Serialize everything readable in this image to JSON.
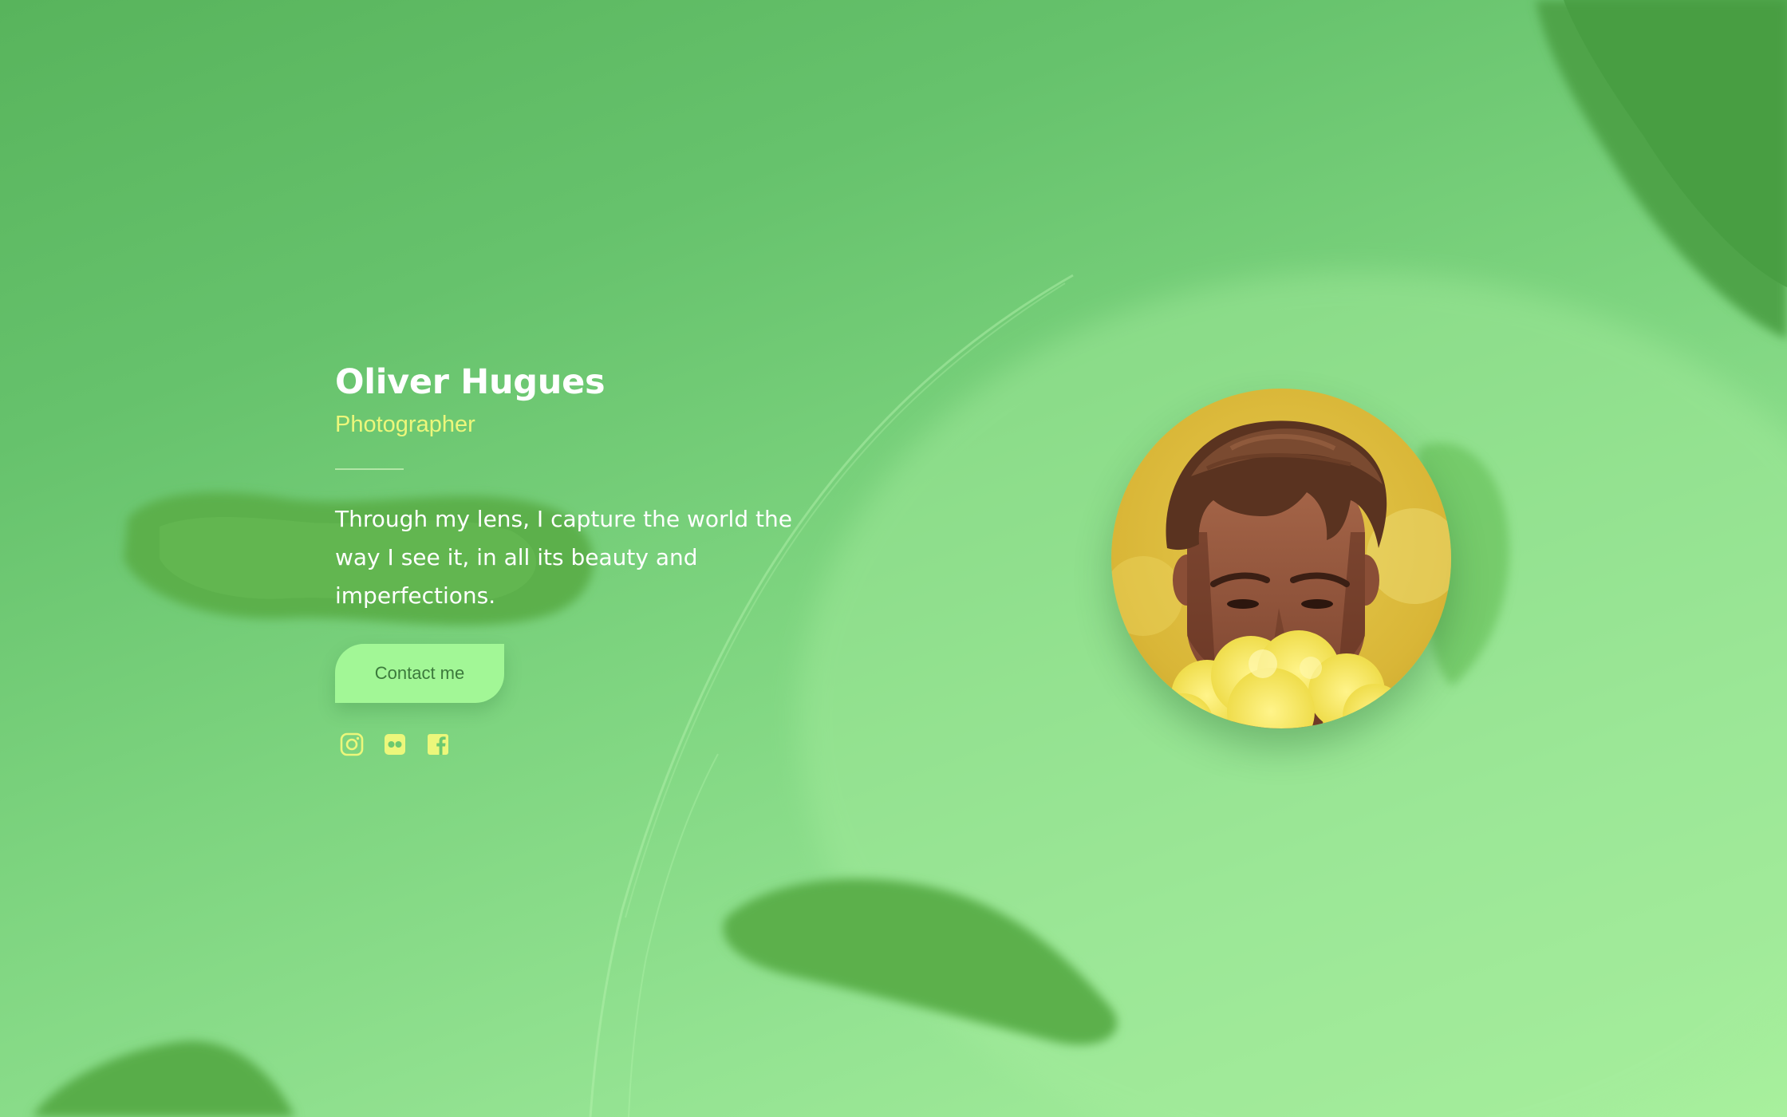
{
  "profile": {
    "name": "Oliver Hugues",
    "role": "Photographer",
    "bio": "Through my lens, I capture the world the way I see it, in all its beauty and imperfections.",
    "contact_label": "Contact me",
    "avatar_icon": "portrait-photo"
  },
  "social": [
    {
      "icon": "instagram-icon"
    },
    {
      "icon": "flickr-icon"
    },
    {
      "icon": "facebook-icon"
    }
  ],
  "colors": {
    "background": "#6cc96f",
    "name_text": "#ffffff",
    "role_text": "#ecf77b",
    "button_bg": "#a2f796",
    "button_text": "#3c7a3c",
    "icon": "#ecf77b"
  }
}
